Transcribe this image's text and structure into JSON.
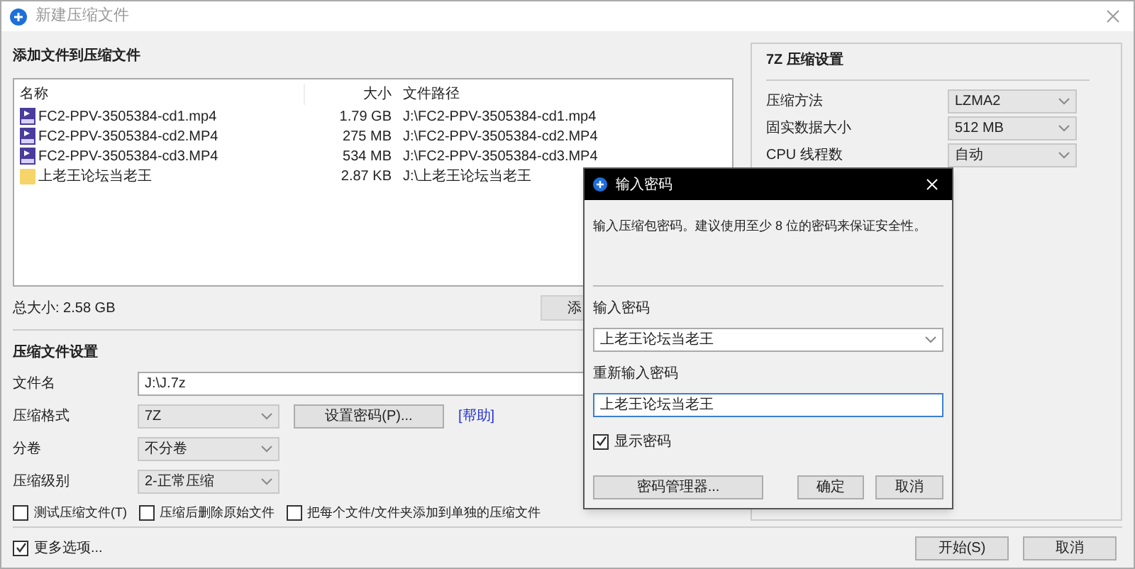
{
  "window": {
    "title": "新建压缩文件"
  },
  "files": {
    "heading": "添加文件到压缩文件",
    "columns": [
      "名称",
      "大小",
      "文件路径"
    ],
    "rows": [
      {
        "kind": "video",
        "name": "FC2-PPV-3505384-cd1.mp4",
        "size": "1.79 GB",
        "path": "J:\\FC2-PPV-3505384-cd1.mp4"
      },
      {
        "kind": "video",
        "name": "FC2-PPV-3505384-cd2.MP4",
        "size": "275 MB",
        "path": "J:\\FC2-PPV-3505384-cd2.MP4"
      },
      {
        "kind": "video",
        "name": "FC2-PPV-3505384-cd3.MP4",
        "size": "534 MB",
        "path": "J:\\FC2-PPV-3505384-cd3.MP4"
      },
      {
        "kind": "folder",
        "name": "上老王论坛当老王",
        "size": "2.87 KB",
        "path": "J:\\上老王论坛当老王"
      }
    ],
    "total": "总大小: 2.58 GB",
    "add_button": "添"
  },
  "settings": {
    "heading": "压缩文件设置",
    "filename_label": "文件名",
    "filename": "J:\\J.7z",
    "format_label": "压缩格式",
    "format": "7Z",
    "password_button": "设置密码(P)...",
    "help_link": "[帮助]",
    "split_label": "分卷",
    "split": "不分卷",
    "level_label": "压缩级别",
    "level": "2-正常压缩",
    "options": [
      {
        "label": "测试压缩文件(T)",
        "checked": false
      },
      {
        "label": "压缩后删除原始文件",
        "checked": false
      },
      {
        "label": "把每个文件/文件夹添加到单独的压缩文件",
        "checked": false
      }
    ]
  },
  "more_options": {
    "label": "更多选项...",
    "checked": true
  },
  "seven_z": {
    "heading": "7Z 压缩设置",
    "rows": [
      {
        "label": "压缩方法",
        "value": "LZMA2"
      },
      {
        "label": "固实数据大小",
        "value": "512 MB"
      },
      {
        "label": "CPU 线程数",
        "value": "自动"
      }
    ]
  },
  "buttons": [
    "开始(S)",
    "取消"
  ],
  "dialog": {
    "title": "输入密码",
    "hint": "输入压缩包密码。建议使用至少 8 位的密码来保证安全性。",
    "password_label": "输入密码",
    "password": "上老王论坛当老王",
    "repeat_label": "重新输入密码",
    "repeat": "上老王论坛当老王",
    "show": {
      "label": "显示密码",
      "checked": true
    },
    "buttons": [
      "密码管理器...",
      "确定",
      "取消"
    ]
  }
}
